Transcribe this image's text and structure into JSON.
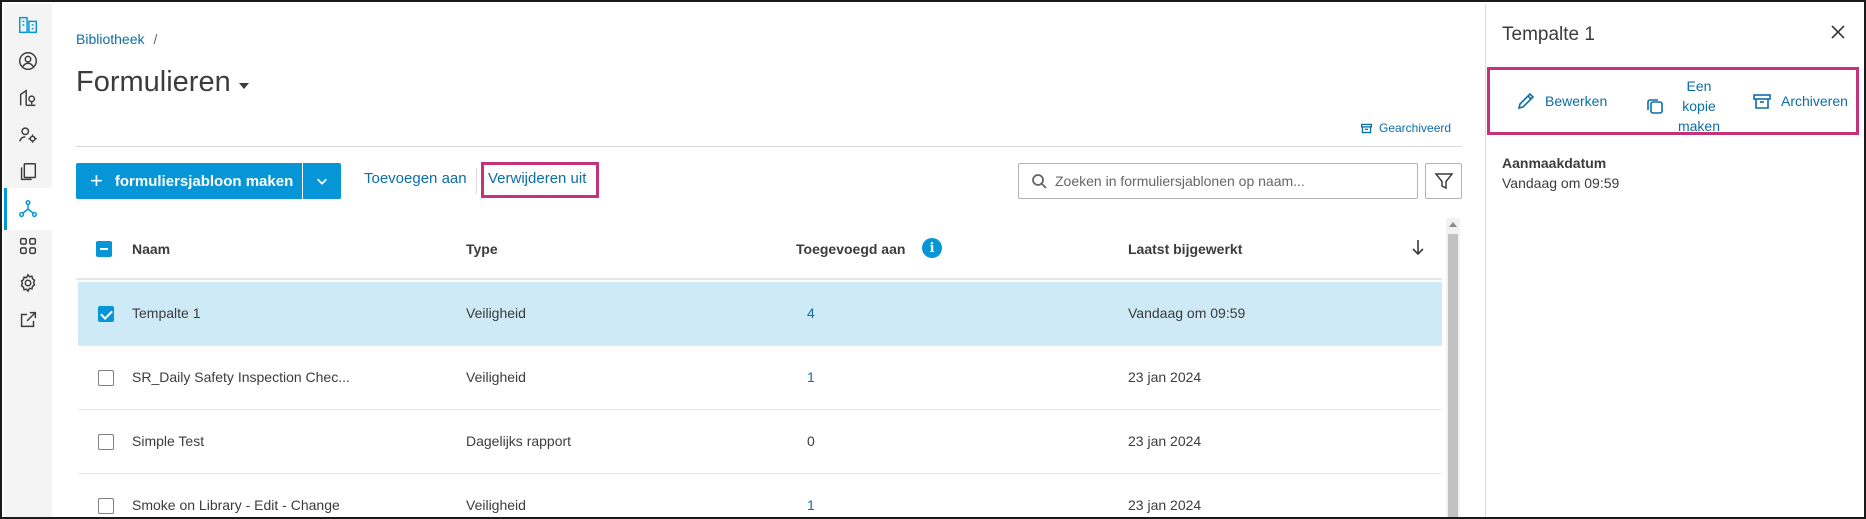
{
  "breadcrumb": {
    "root": "Bibliotheek",
    "separator": "/"
  },
  "page": {
    "title": "Formulieren"
  },
  "toolbar": {
    "archived_label": "Gearchiveerd",
    "create_label": "formuliersjabloon maken",
    "add_to_label": "Toevoegen aan",
    "remove_from_label": "Verwijderen uit",
    "search_placeholder": "Zoeken in formuliersjablonen op naam..."
  },
  "table": {
    "columns": {
      "name": "Naam",
      "type": "Type",
      "added_to": "Toegevoegd aan",
      "updated": "Laatst bijgewerkt"
    },
    "rows": [
      {
        "name": "Tempalte 1",
        "type": "Veiligheid",
        "added_to": "4",
        "updated": "Vandaag om 09:59",
        "selected": true
      },
      {
        "name": "SR_Daily Safety Inspection Chec...",
        "type": "Veiligheid",
        "added_to": "1",
        "updated": "23 jan 2024",
        "selected": false
      },
      {
        "name": "Simple Test",
        "type": "Dagelijks rapport",
        "added_to": "0",
        "updated": "23 jan 2024",
        "selected": false
      },
      {
        "name": "Smoke on Library - Edit - Change",
        "type": "Veiligheid",
        "added_to": "1",
        "updated": "23 jan 2024",
        "selected": false
      }
    ]
  },
  "panel": {
    "title": "Tempalte 1",
    "edit_label": "Bewerken",
    "copy_label": "Een\nkopie\nmaken",
    "archive_label": "Archiveren",
    "created_label": "Aanmaakdatum",
    "created_value": "Vandaag om 09:59"
  },
  "colors": {
    "accent": "#0696d7",
    "link": "#0c6ea8",
    "highlight": "#c3327a",
    "selected_row": "#cdeaf6"
  },
  "icons": {
    "rail": [
      "building-icon",
      "user-icon",
      "location-icon",
      "user-settings-icon",
      "documents-icon",
      "network-icon",
      "apps-icon",
      "gear-icon",
      "external-link-icon"
    ]
  }
}
